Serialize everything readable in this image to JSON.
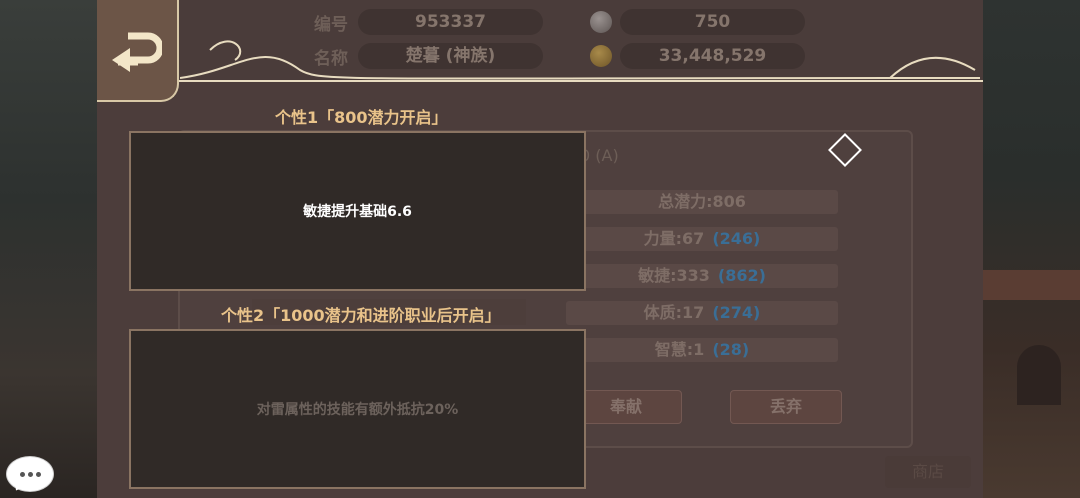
{
  "header": {
    "id_label": "编号",
    "id_value": "953337",
    "name_label": "名称",
    "name_value": "楚暮 (神族)",
    "currency1_icon": "gem-icon",
    "currency1_value": "750",
    "currency2_icon": "gold-coin-icon",
    "currency2_value": "33,448,529"
  },
  "detail": {
    "grade": "0 (A)",
    "stats": [
      {
        "label": "总潜力:806",
        "bonus": ""
      },
      {
        "label": "力量:67",
        "bonus": "(246)"
      },
      {
        "label": "敏捷:333",
        "bonus": "(862)"
      },
      {
        "label": "体质:17",
        "bonus": "(274)"
      },
      {
        "label": "智慧:1",
        "bonus": "(28)"
      }
    ],
    "contribute_label": "奉献",
    "discard_label": "丢弃",
    "corner_label": "商店"
  },
  "popup": {
    "trait1_title": "个性1「800潜力开启」",
    "trait1_text": "敏捷提升基础6.6",
    "trait2_title": "个性2「1000潜力和进阶职业后开启」",
    "trait2_text": "对雷属性的技能有额外抵抗20%"
  },
  "colors": {
    "trait_title": "#e9c38a",
    "bonus_blue": "#3a6e96"
  }
}
